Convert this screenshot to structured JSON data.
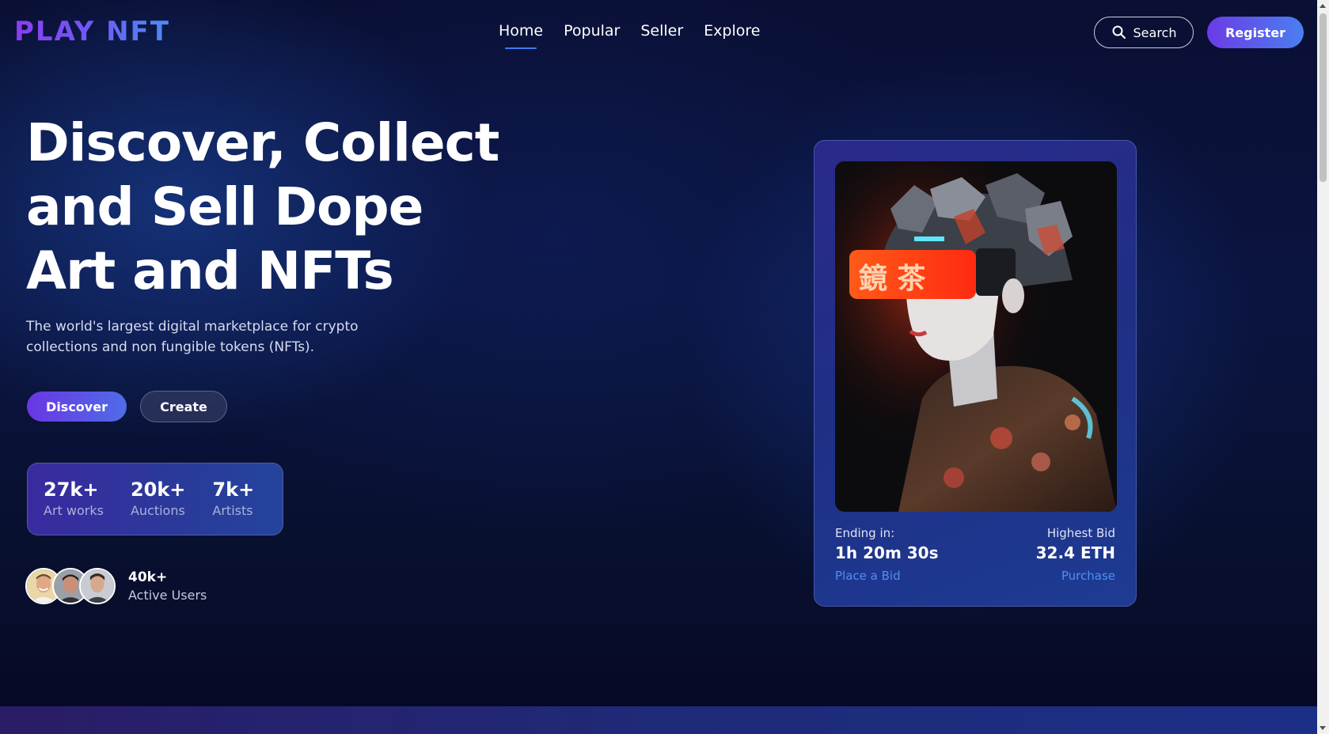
{
  "header": {
    "logo": "PLAY NFT",
    "nav": [
      "Home",
      "Popular",
      "Seller",
      "Explore"
    ],
    "search_label": "Search",
    "register_label": "Register"
  },
  "hero": {
    "title_line1": "Discover, Collect",
    "title_line2": "and Sell Dope",
    "title_line3": "Art and NFTs",
    "subtitle": "The world's largest digital marketplace for crypto collections and non fungible tokens (NFTs).",
    "discover_label": "Discover",
    "create_label": "Create"
  },
  "stats": [
    {
      "value": "27k+",
      "label": "Art works"
    },
    {
      "value": "20k+",
      "label": "Auctions"
    },
    {
      "value": "7k+",
      "label": "Artists"
    }
  ],
  "users": {
    "count": "40k+",
    "label": "Active Users"
  },
  "card": {
    "ending_label": "Ending in:",
    "ending_value": "1h 20m 30s",
    "bid_label": "Highest Bid",
    "bid_value": "32.4 ETH",
    "place_bid": "Place a Bid",
    "purchase": "Purchase",
    "image_alt": "nft-cyber-girl-image",
    "visor_text": "鏡 茶"
  },
  "colors": {
    "accent_purple": "#6a36e4",
    "accent_blue": "#4b7ef0",
    "link_blue": "#4f8ff5"
  }
}
